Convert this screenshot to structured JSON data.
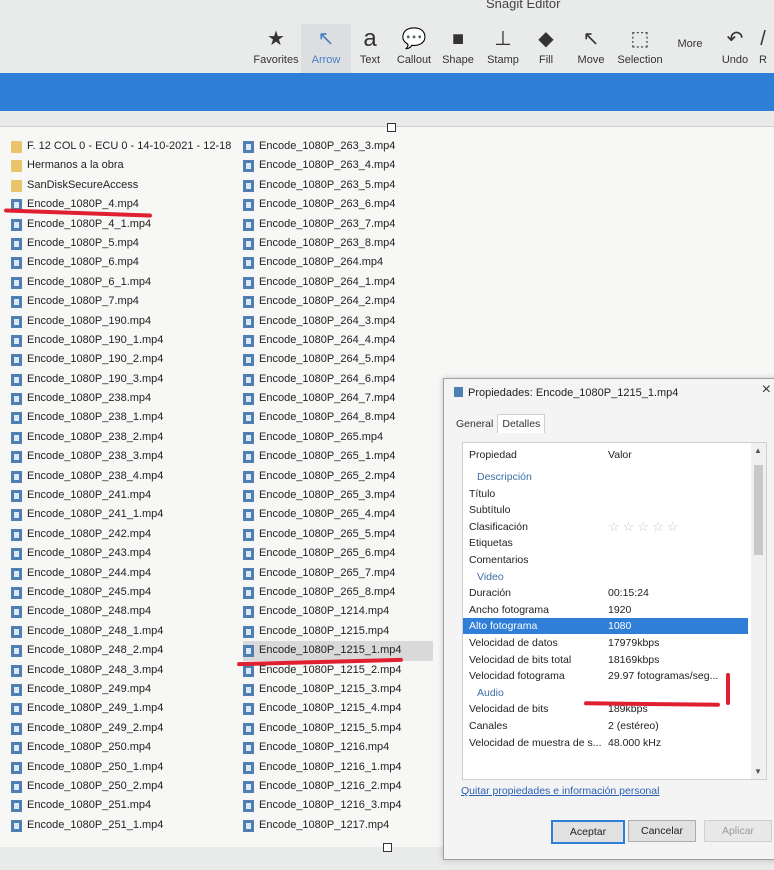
{
  "app": {
    "title": "Snagit Editor"
  },
  "toolbar": {
    "tools": [
      {
        "label": "Favorites",
        "icon": "star-icon"
      },
      {
        "label": "Arrow",
        "icon": "arrow-icon"
      },
      {
        "label": "Text",
        "icon": "text-icon"
      },
      {
        "label": "Callout",
        "icon": "callout-icon"
      },
      {
        "label": "Shape",
        "icon": "shape-icon"
      },
      {
        "label": "Stamp",
        "icon": "stamp-icon"
      },
      {
        "label": "Fill",
        "icon": "fill-icon"
      },
      {
        "label": "Move",
        "icon": "move-icon"
      },
      {
        "label": "Selection",
        "icon": "selection-icon"
      }
    ],
    "more_label": "More",
    "undo_label": "Undo",
    "redo_label": "R"
  },
  "files": {
    "left": [
      "F. 12 COL 0 - ECU 0 - 14-10-2021 - 12-18",
      "Hermanos a la obra",
      "SanDiskSecureAccess",
      "Encode_1080P_4.mp4",
      "Encode_1080P_4_1.mp4",
      "Encode_1080P_5.mp4",
      "Encode_1080P_6.mp4",
      "Encode_1080P_6_1.mp4",
      "Encode_1080P_7.mp4",
      "Encode_1080P_190.mp4",
      "Encode_1080P_190_1.mp4",
      "Encode_1080P_190_2.mp4",
      "Encode_1080P_190_3.mp4",
      "Encode_1080P_238.mp4",
      "Encode_1080P_238_1.mp4",
      "Encode_1080P_238_2.mp4",
      "Encode_1080P_238_3.mp4",
      "Encode_1080P_238_4.mp4",
      "Encode_1080P_241.mp4",
      "Encode_1080P_241_1.mp4",
      "Encode_1080P_242.mp4",
      "Encode_1080P_243.mp4",
      "Encode_1080P_244.mp4",
      "Encode_1080P_245.mp4",
      "Encode_1080P_248.mp4",
      "Encode_1080P_248_1.mp4",
      "Encode_1080P_248_2.mp4",
      "Encode_1080P_248_3.mp4",
      "Encode_1080P_249.mp4",
      "Encode_1080P_249_1.mp4",
      "Encode_1080P_249_2.mp4",
      "Encode_1080P_250.mp4",
      "Encode_1080P_250_1.mp4",
      "Encode_1080P_250_2.mp4",
      "Encode_1080P_251.mp4",
      "Encode_1080P_251_1.mp4"
    ],
    "right": [
      "Encode_1080P_263_3.mp4",
      "Encode_1080P_263_4.mp4",
      "Encode_1080P_263_5.mp4",
      "Encode_1080P_263_6.mp4",
      "Encode_1080P_263_7.mp4",
      "Encode_1080P_263_8.mp4",
      "Encode_1080P_264.mp4",
      "Encode_1080P_264_1.mp4",
      "Encode_1080P_264_2.mp4",
      "Encode_1080P_264_3.mp4",
      "Encode_1080P_264_4.mp4",
      "Encode_1080P_264_5.mp4",
      "Encode_1080P_264_6.mp4",
      "Encode_1080P_264_7.mp4",
      "Encode_1080P_264_8.mp4",
      "Encode_1080P_265.mp4",
      "Encode_1080P_265_1.mp4",
      "Encode_1080P_265_2.mp4",
      "Encode_1080P_265_3.mp4",
      "Encode_1080P_265_4.mp4",
      "Encode_1080P_265_5.mp4",
      "Encode_1080P_265_6.mp4",
      "Encode_1080P_265_7.mp4",
      "Encode_1080P_265_8.mp4",
      "Encode_1080P_1214.mp4",
      "Encode_1080P_1215.mp4",
      "Encode_1080P_1215_1.mp4",
      "Encode_1080P_1215_2.mp4",
      "Encode_1080P_1215_3.mp4",
      "Encode_1080P_1215_4.mp4",
      "Encode_1080P_1215_5.mp4",
      "Encode_1080P_1216.mp4",
      "Encode_1080P_1216_1.mp4",
      "Encode_1080P_1216_2.mp4",
      "Encode_1080P_1216_3.mp4",
      "Encode_1080P_1217.mp4"
    ]
  },
  "dialog": {
    "title": "Propiedades: Encode_1080P_1215_1.mp4",
    "tabs": [
      "General",
      "Detalles"
    ],
    "header": {
      "property": "Propiedad",
      "value": "Valor"
    },
    "rows": [
      {
        "k": "Descripción",
        "v": "",
        "group": true
      },
      {
        "k": "Título",
        "v": ""
      },
      {
        "k": "Subtítulo",
        "v": ""
      },
      {
        "k": "Clasificación",
        "v": "☆☆☆☆☆"
      },
      {
        "k": "Etiquetas",
        "v": ""
      },
      {
        "k": "Comentarios",
        "v": ""
      },
      {
        "k": "Video",
        "v": "",
        "group": true
      },
      {
        "k": "Duración",
        "v": "00:15:24"
      },
      {
        "k": "Ancho fotograma",
        "v": "1920"
      },
      {
        "k": "Alto fotograma",
        "v": "1080",
        "hl": true
      },
      {
        "k": "Velocidad de datos",
        "v": "17979kbps"
      },
      {
        "k": "Velocidad de bits total",
        "v": "18169kbps"
      },
      {
        "k": "Velocidad fotograma",
        "v": "29.97 fotogramas/seg..."
      },
      {
        "k": "Audio",
        "v": "",
        "group": true
      },
      {
        "k": "Velocidad de bits",
        "v": "189kbps"
      },
      {
        "k": "Canales",
        "v": "2 (estéreo)"
      },
      {
        "k": "Velocidad de muestra de s...",
        "v": "48.000 kHz"
      }
    ],
    "link": "Quitar propiedades e información personal",
    "buttons": {
      "ok": "Aceptar",
      "cancel": "Cancelar",
      "apply": "Aplicar"
    }
  },
  "colors": {
    "accent": "#2d7fd6",
    "annotation": "#e02030"
  }
}
